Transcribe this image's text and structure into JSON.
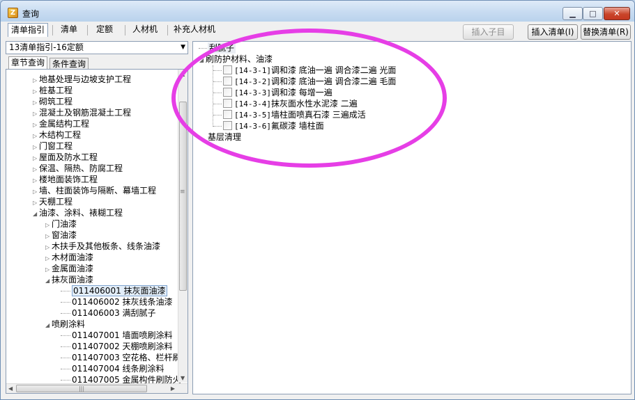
{
  "window": {
    "title": "查询",
    "app_icon_glyph": "Z",
    "controls": {
      "minimize": "▁",
      "maximize": "□",
      "close": "✕"
    }
  },
  "tabs": [
    "清单指引",
    "清单",
    "定额",
    "人材机",
    "补充人材机"
  ],
  "toolbar": {
    "insert_child": "插入子目",
    "insert_list": "插入清单(I)",
    "replace_list": "替换清单(R)"
  },
  "dropdown": {
    "value": "13清单指引-16定额",
    "arrow": "▼"
  },
  "subtabs": [
    "章节查询",
    "条件查询"
  ],
  "left_tree": [
    {
      "label": "地基处理与边坡支护工程",
      "expander": "▷"
    },
    {
      "label": "桩基工程",
      "expander": "▷"
    },
    {
      "label": "砌筑工程",
      "expander": "▷"
    },
    {
      "label": "混凝土及钢筋混凝土工程",
      "expander": "▷"
    },
    {
      "label": "金属结构工程",
      "expander": "▷"
    },
    {
      "label": "木结构工程",
      "expander": "▷"
    },
    {
      "label": "门窗工程",
      "expander": "▷"
    },
    {
      "label": "屋面及防水工程",
      "expander": "▷"
    },
    {
      "label": "保温、隔热、防腐工程",
      "expander": "▷"
    },
    {
      "label": "楼地面装饰工程",
      "expander": "▷"
    },
    {
      "label": "墙、柱面装饰与隔断、幕墙工程",
      "expander": "▷"
    },
    {
      "label": "天棚工程",
      "expander": "▷"
    },
    {
      "label": "油漆、涂料、裱糊工程",
      "expander": "◢"
    },
    {
      "label": "门油漆",
      "expander": "▷"
    },
    {
      "label": "窗油漆",
      "expander": "▷"
    },
    {
      "label": "木扶手及其他板条、线条油漆",
      "expander": "▷"
    },
    {
      "label": "木材面油漆",
      "expander": "▷"
    },
    {
      "label": "金属面油漆",
      "expander": "▷"
    },
    {
      "label": "抹灰面油漆",
      "expander": "◢"
    },
    {
      "label": "011406001   抹灰面油漆",
      "expander": ""
    },
    {
      "label": "011406002   抹灰线条油漆",
      "expander": ""
    },
    {
      "label": "011406003   满刮腻子",
      "expander": ""
    },
    {
      "label": "喷刷涂料",
      "expander": "◢"
    },
    {
      "label": "011407001   墙面喷刷涂料",
      "expander": ""
    },
    {
      "label": "011407002   天棚喷刷涂料",
      "expander": ""
    },
    {
      "label": "011407003   空花格、栏杆刷",
      "expander": ""
    },
    {
      "label": "011407004   线条刷涂料",
      "expander": ""
    },
    {
      "label": "011407005   金属构件刷防火",
      "expander": ""
    }
  ],
  "right_tree": {
    "top_item": "刮腻子",
    "group": "刷防护材料、油漆",
    "group_expander": "◢",
    "items": [
      {
        "code": "[14-3-1]",
        "label": "调和漆 底油一遍 调合漆二遍 光面"
      },
      {
        "code": "[14-3-2]",
        "label": "调和漆 底油一遍 调合漆二遍 毛面"
      },
      {
        "code": "[14-3-3]",
        "label": "调和漆 每增一遍"
      },
      {
        "code": "[14-3-4]",
        "label": "抹灰面水性水泥漆 二遍"
      },
      {
        "code": "[14-3-5]",
        "label": "墙柱面喷真石漆 三遍成活"
      },
      {
        "code": "[14-3-6]",
        "label": "氟碳漆 墙柱面"
      }
    ],
    "bottom_item": "基层清理"
  },
  "scroll": {
    "up": "▲",
    "down": "▼",
    "left": "◀",
    "right": "▶",
    "grip_v": "≡",
    "grip_h": "|||"
  },
  "colors": {
    "highlight_ring": "#e63ee6",
    "close_button": "#c53720"
  }
}
